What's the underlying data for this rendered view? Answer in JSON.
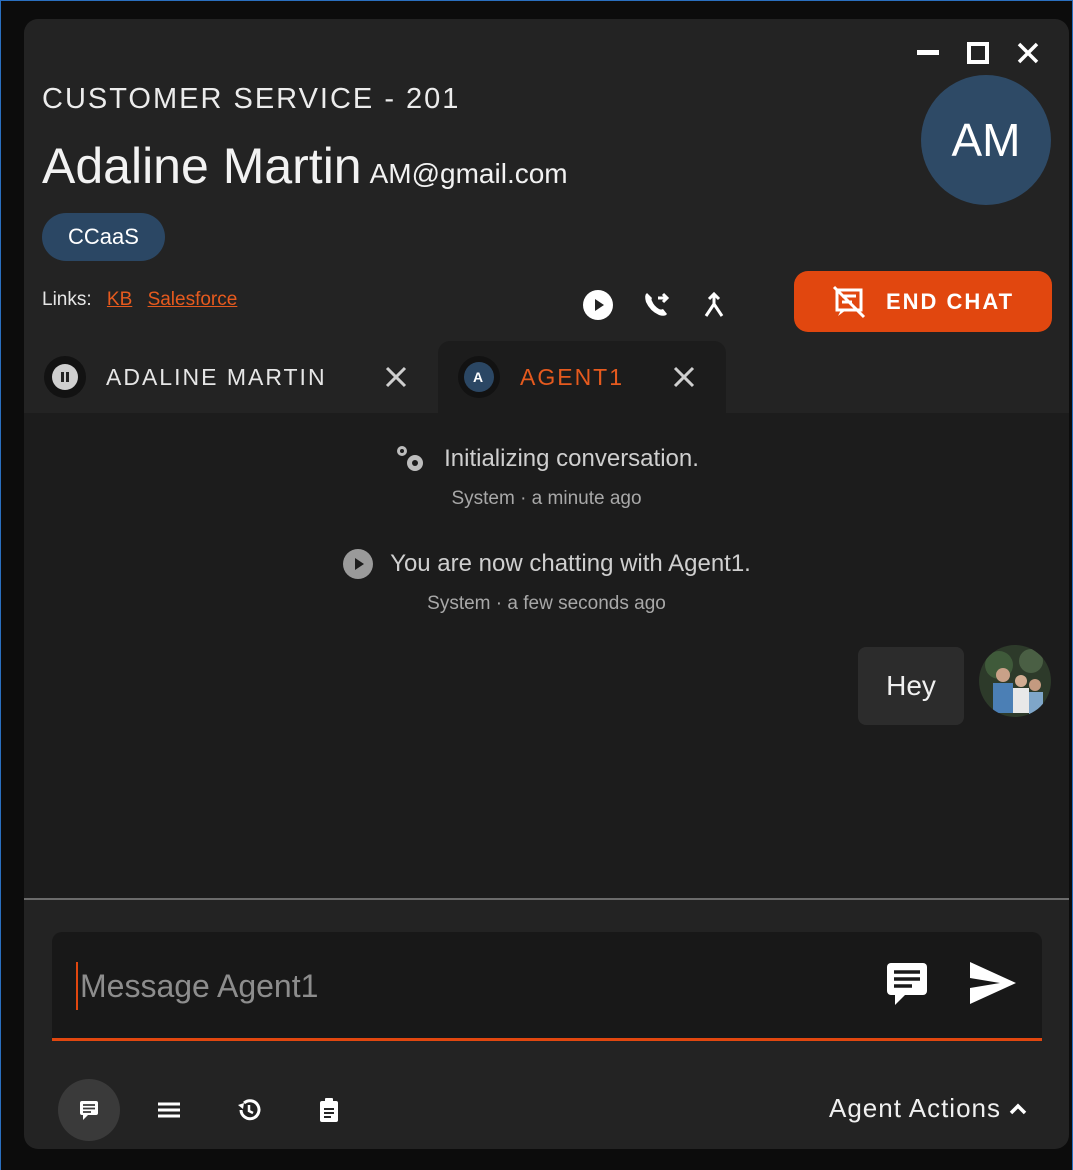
{
  "header": {
    "queue": "CUSTOMER SERVICE - 201",
    "customer_name": "Adaline Martin",
    "customer_email": "AM@gmail.com",
    "avatar_initials": "AM",
    "chip": "CCaaS"
  },
  "links": {
    "label": "Links:",
    "items": [
      "KB",
      "Salesforce"
    ]
  },
  "actions": {
    "end_chat": "END CHAT"
  },
  "tabs": [
    {
      "label": "ADALINE MARTIN",
      "icon": "pause-icon"
    },
    {
      "label": "AGENT1",
      "icon_letter": "A"
    }
  ],
  "messages": [
    {
      "text": "Initializing conversation.",
      "meta": "System · a minute ago",
      "icon": "gears-icon"
    },
    {
      "text": "You are now chatting with Agent1.",
      "meta": "System · a few seconds ago",
      "icon": "play-circle-icon"
    }
  ],
  "user_message": "Hey",
  "input": {
    "placeholder": "Message Agent1"
  },
  "footer": {
    "agent_actions": "Agent Actions"
  },
  "colors": {
    "accent": "#e1470f",
    "chip": "#2b4764"
  }
}
